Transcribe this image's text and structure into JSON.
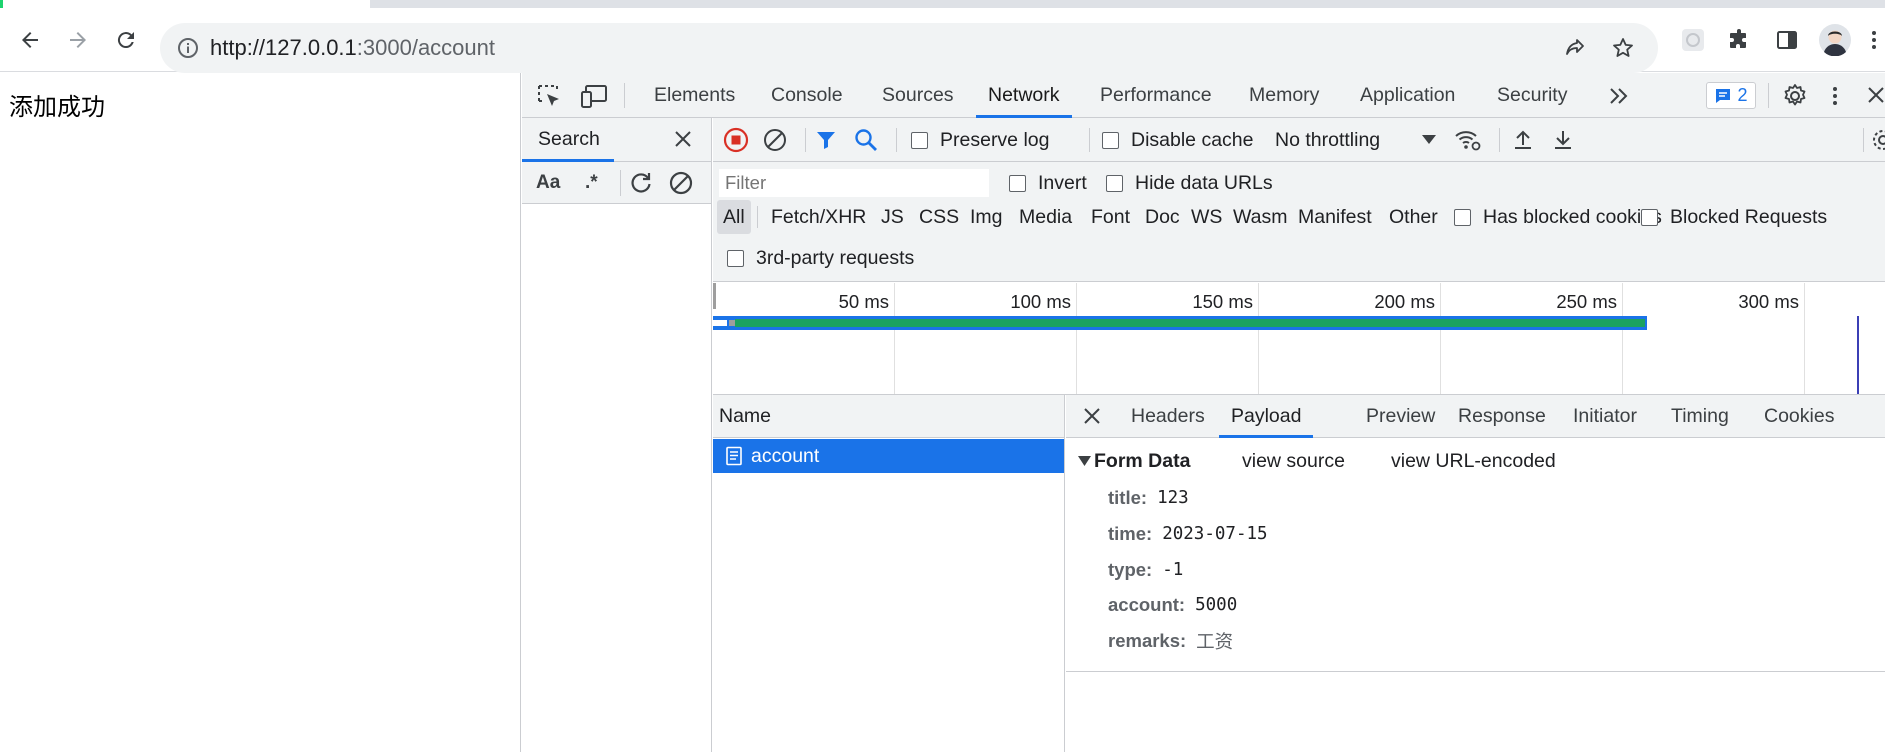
{
  "browser": {
    "url_host": "http://127.0.0.1",
    "url_rest": ":3000/account",
    "colors": {
      "accent": "#1a73e8",
      "tab_indicator": "#1dd36e"
    }
  },
  "page": {
    "text": "添加成功"
  },
  "devtools": {
    "tabs": [
      "Elements",
      "Console",
      "Sources",
      "Network",
      "Performance",
      "Memory",
      "Application",
      "Security"
    ],
    "active_tab": "Network",
    "issues_count": "2",
    "search": {
      "title": "Search",
      "case_label": "Aa",
      "regex_label": ".*"
    },
    "network": {
      "preserve_log": "Preserve log",
      "disable_cache": "Disable cache",
      "throttling": "No throttling",
      "filter_placeholder": "Filter",
      "invert": "Invert",
      "hide_data_urls": "Hide data URLs",
      "types": [
        "All",
        "Fetch/XHR",
        "JS",
        "CSS",
        "Img",
        "Media",
        "Font",
        "Doc",
        "WS",
        "Wasm",
        "Manifest",
        "Other"
      ],
      "active_type": "All",
      "has_blocked_cookies": "Has blocked cookies",
      "blocked_requests": "Blocked Requests",
      "third_party": "3rd-party requests",
      "timeline_ticks": [
        "50 ms",
        "100 ms",
        "150 ms",
        "200 ms",
        "250 ms",
        "300 ms"
      ],
      "name_header": "Name",
      "requests": [
        {
          "name": "account"
        }
      ]
    },
    "details": {
      "tabs": [
        "Headers",
        "Payload",
        "Preview",
        "Response",
        "Initiator",
        "Timing",
        "Cookies"
      ],
      "active_tab": "Payload",
      "form_data_title": "Form Data",
      "view_source": "view source",
      "view_url_encoded": "view URL-encoded",
      "fields": [
        {
          "key": "title:",
          "value": "123"
        },
        {
          "key": "time:",
          "value": "2023-07-15"
        },
        {
          "key": "type:",
          "value": "-1"
        },
        {
          "key": "account:",
          "value": "5000"
        },
        {
          "key": "remarks:",
          "value": "工资"
        }
      ]
    }
  }
}
